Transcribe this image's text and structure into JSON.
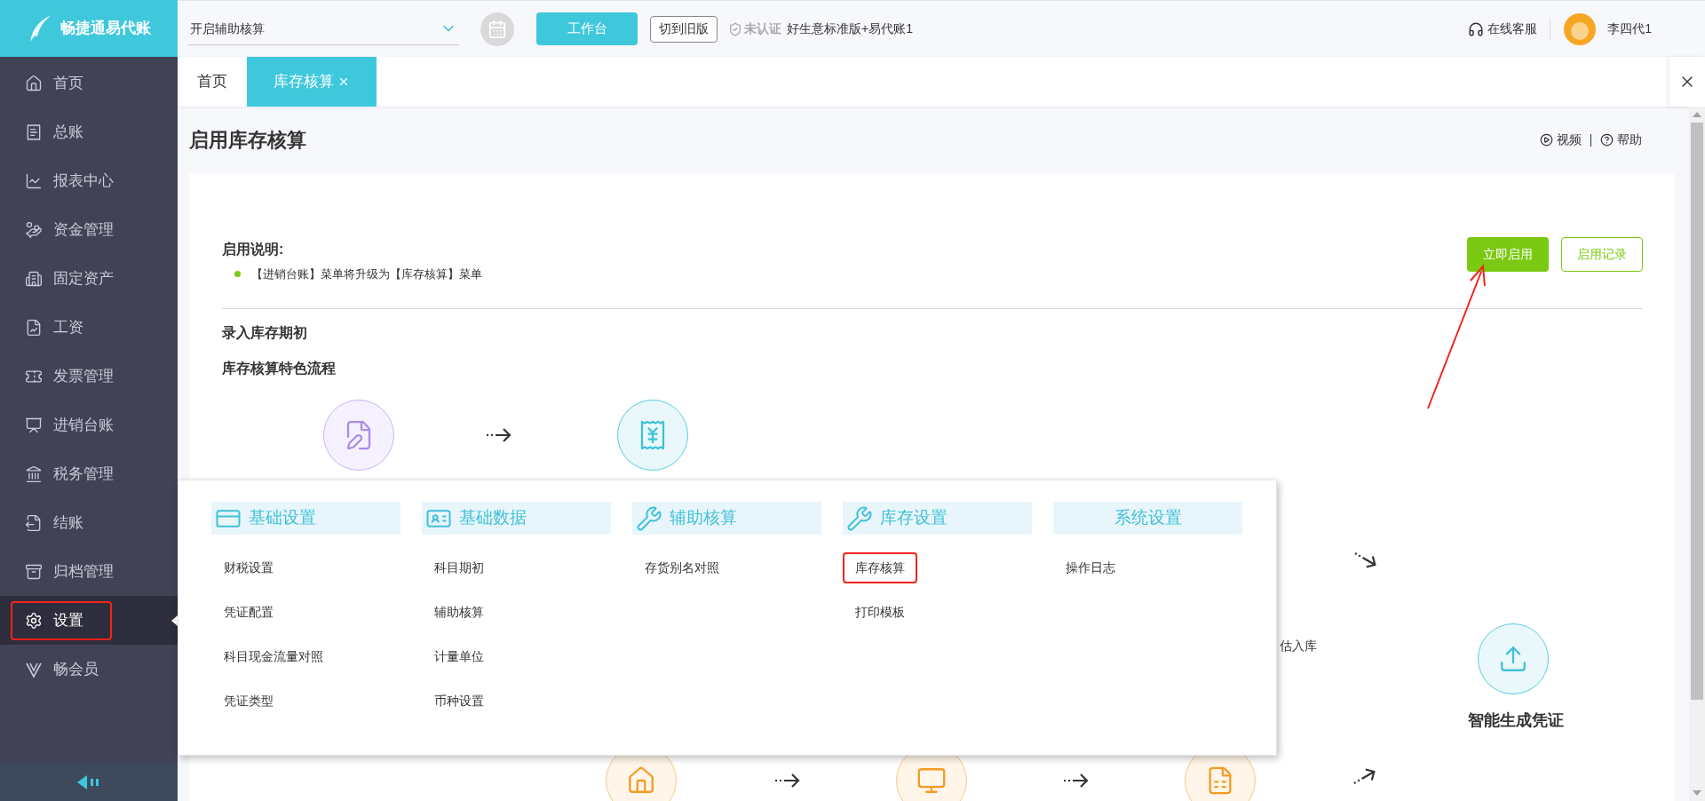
{
  "logo": {
    "text": "畅捷通易代账"
  },
  "header": {
    "select": {
      "value": "开启辅助核算"
    },
    "workbench_button": "工作台",
    "switch_button": "切到旧版",
    "cert_status": "未认证",
    "product": "好生意标准版+易代账1",
    "support": "在线客服",
    "user": "李四代1"
  },
  "sidebar": {
    "items": [
      {
        "label": "首页",
        "selected": false,
        "highlighted": false
      },
      {
        "label": "总账",
        "selected": false,
        "highlighted": false
      },
      {
        "label": "报表中心",
        "selected": false,
        "highlighted": false
      },
      {
        "label": "资金管理",
        "selected": false,
        "highlighted": false
      },
      {
        "label": "固定资产",
        "selected": false,
        "highlighted": false
      },
      {
        "label": "工资",
        "selected": false,
        "highlighted": false
      },
      {
        "label": "发票管理",
        "selected": false,
        "highlighted": false
      },
      {
        "label": "进销台账",
        "selected": false,
        "highlighted": false
      },
      {
        "label": "税务管理",
        "selected": false,
        "highlighted": false
      },
      {
        "label": "结账",
        "selected": false,
        "highlighted": false
      },
      {
        "label": "归档管理",
        "selected": false,
        "highlighted": false
      },
      {
        "label": "设置",
        "selected": true,
        "highlighted": true
      },
      {
        "label": "畅会员",
        "selected": false,
        "highlighted": false
      }
    ]
  },
  "tabs": [
    {
      "label": "首页",
      "selected": false,
      "closable": false
    },
    {
      "label": "库存核算",
      "selected": true,
      "closable": true
    }
  ],
  "page": {
    "title": "启用库存核算",
    "links": [
      "视频",
      "帮助"
    ],
    "notes_title": "启用说明:",
    "notes": [
      "【进销台账】菜单将升级为【库存核算】菜单"
    ],
    "primary_button": "立即启用",
    "secondary_button": "启用记录",
    "section_1": "录入库存期初",
    "section_2": "库存核算特色流程",
    "flow_fragment": "估入库",
    "flow_final": "智能生成凭证"
  },
  "menu": {
    "columns": [
      {
        "title": "基础设置",
        "items": [
          {
            "label": "财税设置",
            "highlighted": false
          },
          {
            "label": "凭证配置",
            "highlighted": false
          },
          {
            "label": "科目现金流量对照",
            "highlighted": false
          },
          {
            "label": "凭证类型",
            "highlighted": false
          }
        ]
      },
      {
        "title": "基础数据",
        "items": [
          {
            "label": "科目期初",
            "highlighted": false
          },
          {
            "label": "辅助核算",
            "highlighted": false
          },
          {
            "label": "计量单位",
            "highlighted": false
          },
          {
            "label": "币种设置",
            "highlighted": false
          }
        ]
      },
      {
        "title": "辅助核算",
        "items": [
          {
            "label": "存货别名对照",
            "highlighted": false
          }
        ]
      },
      {
        "title": "库存设置",
        "items": [
          {
            "label": "库存核算",
            "highlighted": true
          },
          {
            "label": "打印模板",
            "highlighted": false
          }
        ]
      },
      {
        "title": "系统设置",
        "items": [
          {
            "label": "操作日志",
            "highlighted": false
          }
        ]
      }
    ]
  }
}
